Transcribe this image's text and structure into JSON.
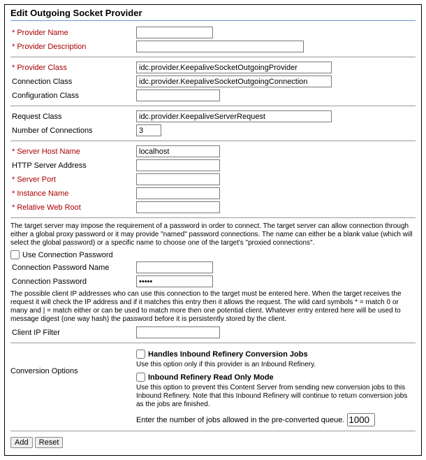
{
  "title": "Edit Outgoing Socket Provider",
  "fields": {
    "provider_name": {
      "label": "* Provider Name",
      "value": ""
    },
    "provider_description": {
      "label": "* Provider Description",
      "value": ""
    },
    "provider_class": {
      "label": "* Provider Class",
      "value": "idc.provider.KeepaliveSocketOutgoingProvider"
    },
    "connection_class": {
      "label": "Connection Class",
      "value": "idc.provider.KeepaliveSocketOutgoingConnection"
    },
    "configuration_class": {
      "label": "Configuration Class",
      "value": ""
    },
    "request_class": {
      "label": "Request Class",
      "value": "idc.provider.KeepaliveServerRequest"
    },
    "num_connections": {
      "label": "Number of Connections",
      "value": "3"
    },
    "server_host": {
      "label": "* Server Host Name",
      "value": "localhost"
    },
    "http_server_address": {
      "label": "HTTP Server Address",
      "value": ""
    },
    "server_port": {
      "label": "* Server Port",
      "value": ""
    },
    "instance_name": {
      "label": "* Instance Name",
      "value": ""
    },
    "relative_web_root": {
      "label": "* Relative Web Root",
      "value": ""
    },
    "use_conn_pwd": {
      "label": "Use Connection Password"
    },
    "conn_pwd_name": {
      "label": "Connection Password Name",
      "value": ""
    },
    "conn_pwd": {
      "label": "Connection Password",
      "value": "•••••"
    },
    "client_ip_filter": {
      "label": "Client IP Filter",
      "value": ""
    }
  },
  "text": {
    "proxy_desc": "The target server may impose the requirement of a password in order to connect. The target server can allow connection through either a global proxy password or it may provide \"named\" password connections. The name can either be a blank value (which will select the global password) or a specific name to choose one of the target's \"proxied connections\".",
    "ipfilter_desc": "The possible client IP addresses who can use this connection to the target must be entered here. When the target receives the request it will check the IP address and if it matches this entry then it allows the request. The wild card symbols * = match 0 or many and | = match either or can be used to match more then one potential client. Whatever entry entered here will be used to message digest (one way hash) the password before it is persistently stored by the client."
  },
  "conversion": {
    "label": "Conversion Options",
    "handles_label": "Handles Inbound Refinery Conversion Jobs",
    "handles_desc": "Use this option only if this provider is an Inbound Refinery.",
    "readonly_label": "Inbound Refinery Read Only Mode",
    "readonly_desc": "Use this option to prevent this Content Server from sending new conversion jobs to this Inbound Refinery. Note that this Inbound Refinery will continue to return conversion jobs as the jobs are finished.",
    "queue_label": "Enter the number of jobs allowed in the pre-converted queue.",
    "queue_value": "1000"
  },
  "buttons": {
    "add": "Add",
    "reset": "Reset"
  }
}
